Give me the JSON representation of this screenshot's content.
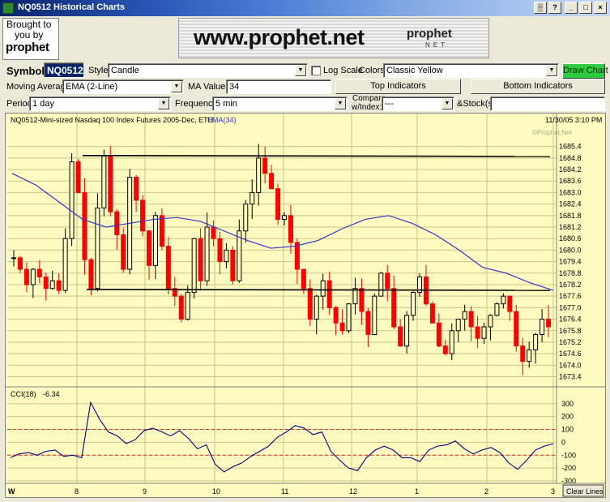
{
  "window": {
    "title": "NQ0512 Historical Charts",
    "controls": [
      "▒",
      "?",
      "_",
      "□",
      "×"
    ]
  },
  "banner": {
    "brought_line1": "Brought to",
    "brought_line2": "you by",
    "sponsor_logo": "prophet",
    "ad_url": "www.prophet.net",
    "ad_logo": "prophet",
    "ad_logo_sub": "NET"
  },
  "controls": {
    "symbol_label": "Symbol",
    "symbol_value": "NQ0512",
    "style_label": "Style",
    "style_value": "Candle",
    "logscale_label": "Log Scale",
    "colors_label": "Colors",
    "colors_value": "Classic Yellow",
    "draw_button": "Draw Chart",
    "ma_label": "Moving Average",
    "ma_value": "EMA (2-Line)",
    "ma_values_label": "MA Values",
    "ma_values_value": "34",
    "top_indicators": "Top Indicators",
    "bottom_indicators": "Bottom Indicators",
    "period_label": "Period",
    "period_value": "1 day",
    "frequency_label": "Frequency",
    "frequency_value": "5 min",
    "compare_label_1": "Compare",
    "compare_label_2": "w/Index:",
    "compare_value": "---",
    "stocks_label": "&Stock(s)",
    "stocks_value": ""
  },
  "chart": {
    "header": "NQ0512-Mini-sized Nasdaq 100 Index Futures 2005-Dec, ETH",
    "ema_label": "EMA(34)",
    "timestamp": "11/30/05 3:10 PM",
    "watermark": "©Prophet.Net",
    "cci_label": "CCI(18)",
    "cci_value": "-6.34",
    "clear_lines": "Clear Lines",
    "corner_label": "W",
    "colors": {
      "up": "#000000",
      "down": "#ff0000",
      "ema": "#3333cc",
      "grid": "#c8c68a",
      "cci": "#000080",
      "cci_ref": "#cc3333"
    }
  },
  "chart_data": [
    {
      "type": "candlestick",
      "title": "NQ0512-Mini-sized Nasdaq 100 Index Futures 2005-Dec, ETH",
      "ylim": [
        1673.0,
        1686.4
      ],
      "y_ticks": [
        "1673.4",
        "1674.0",
        "1674.6",
        "1675.2",
        "1675.8",
        "1676.4",
        "1677.0",
        "1677.6",
        "1678.2",
        "1678.8",
        "1679.4",
        "1680.0",
        "1680.6",
        "1681.2",
        "1681.8",
        "1682.4",
        "1683.0",
        "1683.6",
        "1684.2",
        "1684.8",
        "1685.4"
      ],
      "x_ticks": [
        "8",
        "9",
        "10",
        "11",
        "12",
        "1",
        "2",
        "3"
      ],
      "series": [
        {
          "name": "EMA(34)",
          "values": [
            1684.0,
            1683.4,
            1682.5,
            1681.6,
            1681.2,
            1681.4,
            1681.6,
            1681.7,
            1681.5,
            1681.0,
            1680.5,
            1680.1,
            1680.2,
            1680.5,
            1681.1,
            1681.6,
            1681.8,
            1681.4,
            1680.8,
            1680.0,
            1679.1,
            1678.8,
            1678.3,
            1677.9
          ]
        }
      ],
      "annotations": [
        {
          "type": "trendline",
          "y_start": 1684.93,
          "y_end": 1684.88
        },
        {
          "type": "trendline",
          "y_start": 1677.95,
          "y_end": 1677.9
        }
      ]
    },
    {
      "type": "line",
      "title": "CCI(18)",
      "ylim": [
        -300,
        330
      ],
      "y_ticks": [
        "300",
        "200",
        "100",
        "0",
        "-100",
        "-200",
        "-300"
      ],
      "reference_lines": [
        100,
        -100
      ],
      "series": [
        {
          "name": "CCI(18)",
          "values": [
            -120,
            -90,
            -80,
            -100,
            -70,
            -60,
            -110,
            -100,
            -120,
            310,
            180,
            80,
            50,
            -10,
            20,
            90,
            110,
            80,
            50,
            90,
            30,
            -50,
            -20,
            -170,
            -230,
            -190,
            -160,
            -110,
            -70,
            -30,
            40,
            80,
            130,
            110,
            60,
            80,
            -70,
            -140,
            -200,
            -220,
            -120,
            -60,
            -30,
            -60,
            -120,
            -120,
            -150,
            -60,
            -30,
            -20,
            10,
            -50,
            -90,
            -60,
            -40,
            -80,
            -160,
            -210,
            -140,
            -60,
            -30,
            -10
          ]
        }
      ]
    }
  ]
}
